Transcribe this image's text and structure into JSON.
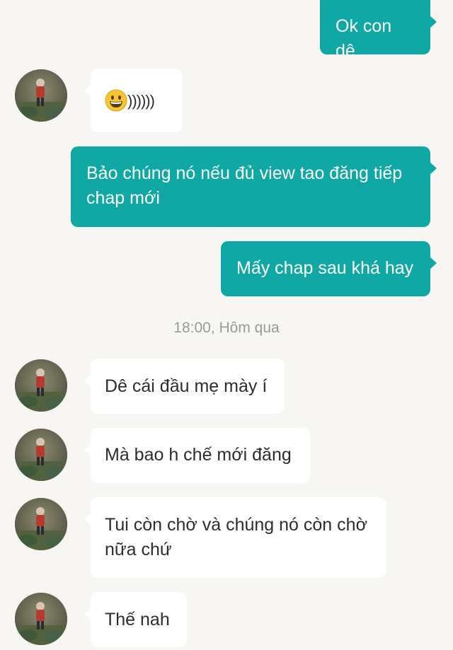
{
  "messages": [
    {
      "id": "m1",
      "direction": "outgoing",
      "text": "Ok con dê"
    },
    {
      "id": "m2",
      "direction": "incoming",
      "emoji": "grinning-face",
      "text": "))))))"
    },
    {
      "id": "m3",
      "direction": "outgoing",
      "lines": [
        "Bảo chúng nó nếu đủ view tao đăng tiếp",
        "chap mới"
      ]
    },
    {
      "id": "m4",
      "direction": "outgoing",
      "text": "Mấy chap sau khá hay"
    },
    {
      "id": "m5",
      "direction": "incoming",
      "text": "Dê cái đầu mẹ mày í"
    },
    {
      "id": "m6",
      "direction": "incoming",
      "text": "Mà bao h chế mới đăng"
    },
    {
      "id": "m7",
      "direction": "incoming",
      "lines": [
        "Tui còn chờ và chúng nó còn chờ",
        "nữa chứ"
      ]
    },
    {
      "id": "m8",
      "direction": "incoming",
      "text": "Thế nah"
    }
  ],
  "timestamp": "18:00, Hôm qua",
  "colors": {
    "background": "#f7f6f2",
    "outgoing_bubble": "#0fa8a5",
    "incoming_bubble": "#ffffff",
    "timestamp_text": "#9a9a9a"
  },
  "icons": {
    "avatar": "user-avatar-photo",
    "emoji": "grinning-face-emoji"
  }
}
